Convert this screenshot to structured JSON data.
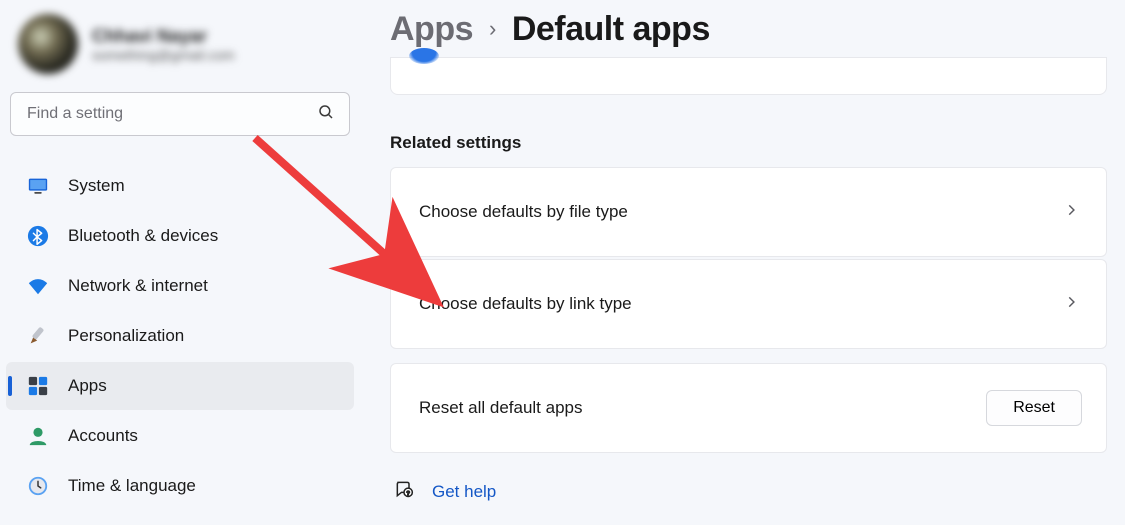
{
  "profile": {
    "name": "Chhavi Nayar",
    "email": "something@gmail.com"
  },
  "search": {
    "placeholder": "Find a setting"
  },
  "sidebar": {
    "items": [
      {
        "label": "System"
      },
      {
        "label": "Bluetooth & devices"
      },
      {
        "label": "Network & internet"
      },
      {
        "label": "Personalization"
      },
      {
        "label": "Apps"
      },
      {
        "label": "Accounts"
      },
      {
        "label": "Time & language"
      }
    ]
  },
  "breadcrumb": {
    "parent": "Apps",
    "current": "Default apps"
  },
  "related": {
    "title": "Related settings",
    "rows": [
      {
        "label": "Choose defaults by file type"
      },
      {
        "label": "Choose defaults by link type"
      }
    ],
    "reset_label": "Reset all default apps",
    "reset_button": "Reset"
  },
  "help": {
    "label": "Get help"
  },
  "colors": {
    "accent": "#1861d6",
    "link": "#1457c6",
    "arrow": "#ed3c3c"
  }
}
